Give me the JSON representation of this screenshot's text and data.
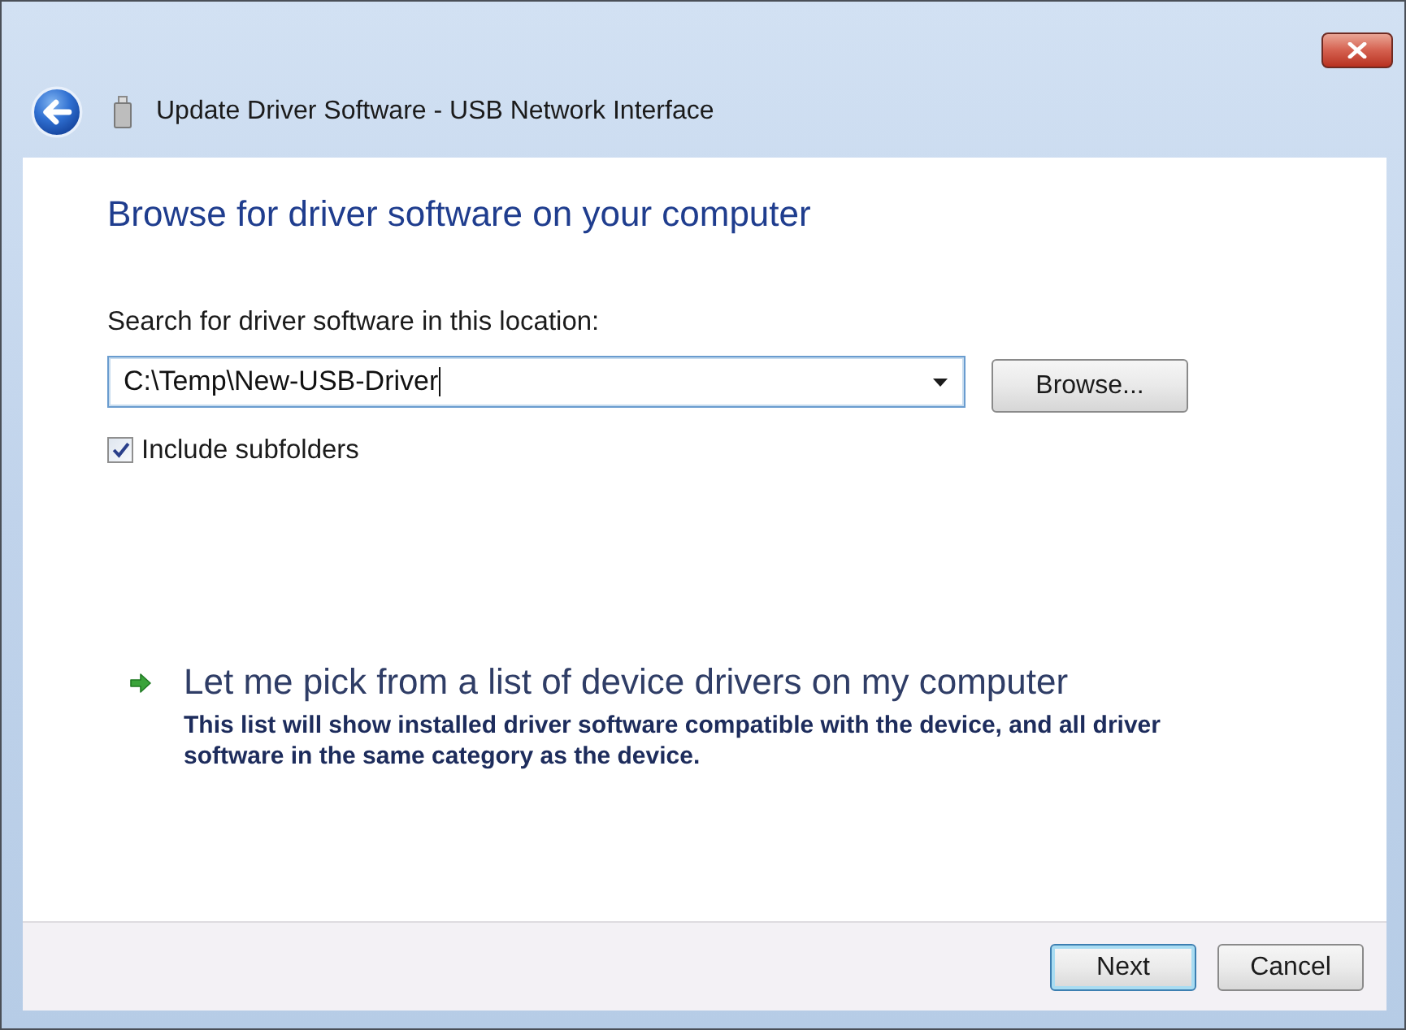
{
  "window": {
    "title": "Update Driver Software - USB Network Interface"
  },
  "heading": "Browse for driver software on your computer",
  "location": {
    "label": "Search for driver software in this location:",
    "value": "C:\\Temp\\New-USB-Driver",
    "focused": true
  },
  "browse_button": {
    "label": "Browse..."
  },
  "include_subfolders": {
    "label": "Include subfolders",
    "checked": true
  },
  "pick_link": {
    "label": "Let me pick from a list of device drivers on my computer",
    "description": "This list will show installed driver software compatible with the device, and all driver software in the same category as the device."
  },
  "buttons": [
    {
      "label": "Next",
      "default": true
    },
    {
      "label": "Cancel",
      "default": false
    }
  ]
}
